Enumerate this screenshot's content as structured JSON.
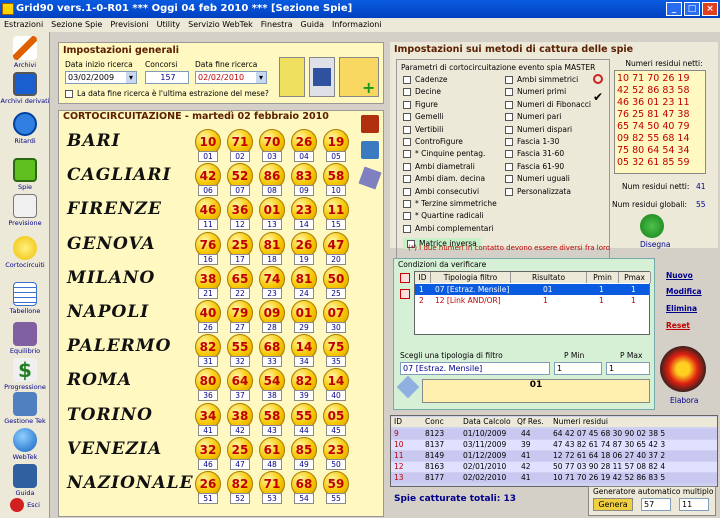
{
  "window": {
    "title": "Grid90 vers.1-0-R01  ***  Oggi 04 feb 2010  ***  [Sezione Spie]"
  },
  "menu": [
    "Estrazioni",
    "Sezione Spie",
    "Previsioni",
    "Utility",
    "Servizio WebTek",
    "Finestra",
    "Guida",
    "Informazioni"
  ],
  "sidebar": [
    "Archivi",
    "Archivi derivati",
    "Ritardi",
    "Spie",
    "Previsione",
    "Cortocircuiti",
    "Tabellone",
    "Equilibrio",
    "Progressione",
    "Gestione Tek",
    "WebTek",
    "Guida",
    "Esci"
  ],
  "general": {
    "title": "Impostazioni generali",
    "start_label": "Data inizio ricerca",
    "start_value": "03/02/2009",
    "concorsi_label": "Concorsi",
    "concorsi_value": "157",
    "end_label": "Data fine ricerca",
    "end_value": "02/02/2010",
    "check_label": "La data fine ricerca è l'ultima estrazione del mese?"
  },
  "cortocircuitazione": {
    "title": "CORTOCIRCUITAZIONE - martedì 02 febbraio 2010",
    "wheels": [
      {
        "name": "BARI",
        "nums": [
          "10",
          "71",
          "70",
          "26",
          "19"
        ],
        "idx": [
          "01",
          "02",
          "03",
          "04",
          "05"
        ]
      },
      {
        "name": "CAGLIARI",
        "nums": [
          "42",
          "52",
          "86",
          "83",
          "58"
        ],
        "idx": [
          "06",
          "07",
          "08",
          "09",
          "10"
        ]
      },
      {
        "name": "FIRENZE",
        "nums": [
          "46",
          "36",
          "01",
          "23",
          "11"
        ],
        "idx": [
          "11",
          "12",
          "13",
          "14",
          "15"
        ]
      },
      {
        "name": "GENOVA",
        "nums": [
          "76",
          "25",
          "81",
          "26",
          "47"
        ],
        "idx": [
          "16",
          "17",
          "18",
          "19",
          "20"
        ]
      },
      {
        "name": "MILANO",
        "nums": [
          "38",
          "65",
          "74",
          "81",
          "50"
        ],
        "idx": [
          "21",
          "22",
          "23",
          "24",
          "25"
        ]
      },
      {
        "name": "NAPOLI",
        "nums": [
          "40",
          "79",
          "09",
          "01",
          "07"
        ],
        "idx": [
          "26",
          "27",
          "28",
          "29",
          "30"
        ]
      },
      {
        "name": "PALERMO",
        "nums": [
          "82",
          "55",
          "68",
          "14",
          "75"
        ],
        "idx": [
          "31",
          "32",
          "33",
          "34",
          "35"
        ]
      },
      {
        "name": "ROMA",
        "nums": [
          "80",
          "64",
          "54",
          "82",
          "14"
        ],
        "idx": [
          "36",
          "37",
          "38",
          "39",
          "40"
        ]
      },
      {
        "name": "TORINO",
        "nums": [
          "34",
          "38",
          "58",
          "55",
          "05"
        ],
        "idx": [
          "41",
          "42",
          "43",
          "44",
          "45"
        ]
      },
      {
        "name": "VENEZIA",
        "nums": [
          "32",
          "25",
          "61",
          "85",
          "23"
        ],
        "idx": [
          "46",
          "47",
          "48",
          "49",
          "50"
        ]
      },
      {
        "name": "NAZIONALE",
        "nums": [
          "26",
          "82",
          "71",
          "68",
          "59"
        ],
        "idx": [
          "51",
          "52",
          "53",
          "54",
          "55"
        ]
      }
    ]
  },
  "methods": {
    "title": "Impostazioni sui metodi di cattura delle spie",
    "params_title": "Parametri di cortocircuitazione evento spia MASTER",
    "col1": [
      "Cadenze",
      "Decine",
      "Figure",
      "Gemelli",
      "Vertibili",
      "ControFigure",
      "* Cinquine pentag.",
      "Ambi diametrali",
      "Ambi diam. decina",
      "Ambi consecutivi",
      "* Terzine simmetriche",
      "* Quartine radicali",
      "Ambi complementari"
    ],
    "col2": [
      "Ambi simmetrici",
      "Numeri primi",
      "Numeri di Fibonacci",
      "Numeri pari",
      "Numeri dispari",
      "Fascia 1-30",
      "Fascia 31-60",
      "Fascia 61-90",
      "Numeri uguali",
      "Personalizzata"
    ],
    "matrice": "Matrice inversa",
    "note": "(*) I due numeri in contatto devono essere diversi fra loro",
    "residui_title": "Numeri residui netti:",
    "residui": "10 71 70 26 19 42 52 86 83 58 46 36 01 23 11 76 25 81 47 38 65 74 50 40 79 09 82 55 68 14 75 80 64 54 34 05 32 61 85 59",
    "residui_netti_label": "Num residui netti:",
    "residui_netti": "41",
    "residui_globali_label": "Num residui globali:",
    "residui_globali": "55",
    "disegna": "Disegna"
  },
  "conditions": {
    "title": "Condizioni da verificare",
    "headers": [
      "ID",
      "Tipologia filtro",
      "Risultato",
      "Pmin",
      "Pmax"
    ],
    "rows": [
      {
        "id": "1",
        "tipo": "07 [Estraz. Mensile]",
        "ris": "01",
        "pmin": "1",
        "pmax": "1"
      },
      {
        "id": "2",
        "tipo": "12 [Link AND/OR]",
        "ris": "1",
        "pmin": "1",
        "pmax": "1"
      }
    ],
    "buttons": [
      "Nuovo",
      "Modifica",
      "Elimina",
      "Reset"
    ],
    "select_label": "Scegli una tipologia di filtro",
    "select_value": "07 [Estraz. Mensile]",
    "pmin_label": "P Min",
    "pmin_value": "1",
    "pmax_label": "P Max",
    "pmax_value": "1",
    "result_value": "01",
    "elabora": "Elabora"
  },
  "results": {
    "headers": [
      "ID",
      "Conc",
      "Data Calcolo",
      "Qf Res.",
      "Numeri residui"
    ],
    "rows": [
      [
        "9",
        "8123",
        "01/10/2009",
        "44",
        "64 42 07 45 68 30 90 02 38 5"
      ],
      [
        "10",
        "8137",
        "03/11/2009",
        "39",
        "47 43 82 61 74 87 30 65 42 3"
      ],
      [
        "11",
        "8149",
        "01/12/2009",
        "41",
        "12 72 61 64 18 06 27 40 37 2"
      ],
      [
        "12",
        "8163",
        "02/01/2010",
        "42",
        "50 77 03 90 28 11 57 08 82 4"
      ],
      [
        "13",
        "8177",
        "02/02/2010",
        "41",
        "10 71 70 26 19 42 52 86 83 5"
      ]
    ],
    "total": "Spie catturate totali: 13",
    "generator_title": "Generatore automatico multiplo",
    "genera": "Genera",
    "g1": "57",
    "g2": "11"
  },
  "colors": {
    "titlebar": "#0a5be0",
    "panel": "#fff8c0",
    "number": "#c00000",
    "index": "#00008b"
  }
}
